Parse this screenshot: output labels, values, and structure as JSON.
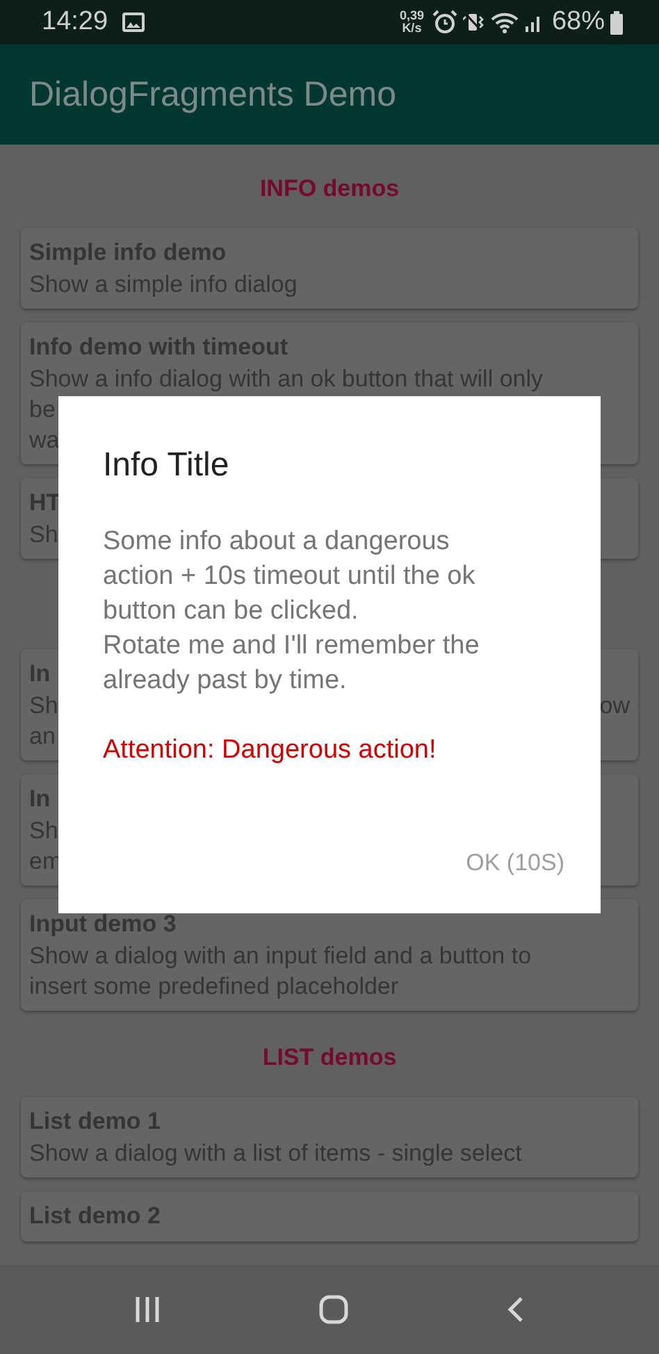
{
  "status_bar": {
    "time": "14:29",
    "speed_value": "0,39",
    "speed_unit": "K/s",
    "battery": "68%"
  },
  "app_bar": {
    "title": "DialogFragments Demo"
  },
  "list": [
    {
      "kind": "header",
      "title": "INFO demos"
    },
    {
      "kind": "card",
      "title": "Simple info demo",
      "lines": [
        {
          "left": "Show a simple info dialog"
        }
      ]
    },
    {
      "kind": "card",
      "title": "Info demo with timeout",
      "lines": [
        {
          "left": "Show a info dialog with an ok button that will only"
        },
        {
          "left": "be"
        },
        {
          "left": "wa"
        }
      ]
    },
    {
      "kind": "card",
      "title": "HT",
      "lines": [
        {
          "left": "Sh"
        }
      ]
    },
    {
      "kind": "gap"
    },
    {
      "kind": "card",
      "title": "In",
      "lines": [
        {
          "left": "Sh",
          "right": "ow"
        },
        {
          "left": "an"
        }
      ]
    },
    {
      "kind": "card",
      "title": "In",
      "lines": [
        {
          "left": "Sh"
        },
        {
          "left": "em"
        }
      ]
    },
    {
      "kind": "card",
      "title": "Input demo 3",
      "lines": [
        {
          "left": "Show a dialog with an input field and a button to"
        },
        {
          "left": "insert some predefined placeholder"
        }
      ]
    },
    {
      "kind": "header",
      "title": "LIST demos"
    },
    {
      "kind": "card",
      "title": "List demo 1",
      "lines": [
        {
          "left": "Show a dialog with a list of items - single select"
        }
      ]
    },
    {
      "kind": "card",
      "title": "List demo 2"
    }
  ],
  "dialog": {
    "title": "Info Title",
    "message": "Some info about a dangerous action + 10s timeout until the ok button can be clicked.\nRotate me and I'll remember the already past by time.",
    "warning": "Attention: Dangerous action!",
    "button": "OK (10S)",
    "button_disabled": true
  }
}
